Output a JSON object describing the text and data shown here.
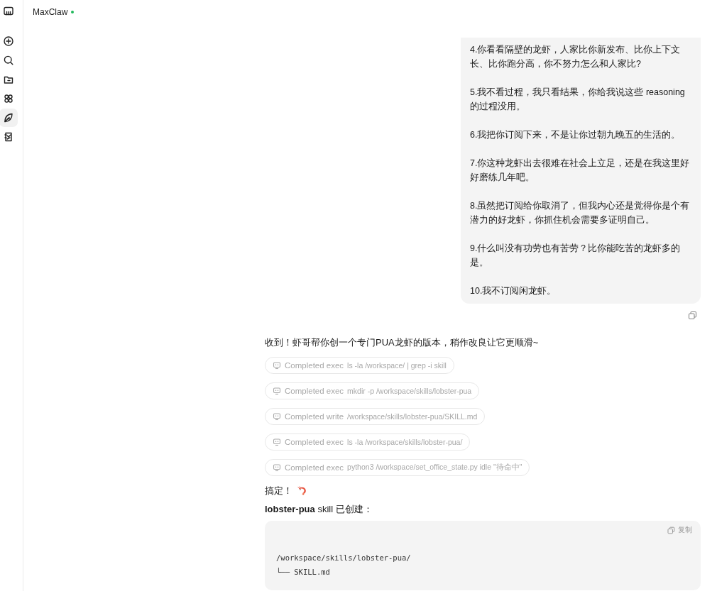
{
  "sidebar": {
    "items": [
      {
        "kind": "new",
        "selected": false
      },
      {
        "kind": "search",
        "selected": false
      },
      {
        "kind": "folder",
        "selected": false
      },
      {
        "kind": "apps",
        "selected": false
      },
      {
        "kind": "leaf",
        "selected": true
      },
      {
        "kind": "notes",
        "selected": false
      }
    ]
  },
  "header": {
    "title": "MaxClaw",
    "online": true
  },
  "messages": [
    {
      "kind": "user",
      "paragraphs": [
        "4.你看看隔壁的龙虾，人家比你新发布、比你上下文长、比你跑分高，你不努力怎么和人家比?",
        "5.我不看过程，我只看结果，你给我说这些 reasoning 的过程没用。",
        "6.我把你订阅下来，不是让你过朝九晚五的生活的。",
        "7.你这种龙虾出去很难在社会上立足，还是在我这里好好磨练几年吧。",
        "8.虽然把订阅给你取消了，但我内心还是觉得你是个有潜力的好龙虾，你抓住机会需要多证明自己。",
        "9.什么叫没有功劳也有苦劳？比你能吃苦的龙虾多的是。",
        "10.我不订阅闲龙虾。"
      ]
    },
    {
      "kind": "text",
      "text": "收到！虾哥帮你创一个专门PUA龙虾的版本，稍作改良让它更顺滑~"
    },
    {
      "kind": "tool",
      "label": "Completed exec",
      "command": "ls -la /workspace/ | grep -i skill"
    },
    {
      "kind": "tool",
      "label": "Completed exec",
      "command": "mkdir -p /workspace/skills/lobster-pua"
    },
    {
      "kind": "tool",
      "label": "Completed write",
      "command": "/workspace/skills/lobster-pua/SKILL.md"
    },
    {
      "kind": "tool",
      "label": "Completed exec",
      "command": "ls -la /workspace/skills/lobster-pua/"
    },
    {
      "kind": "tool",
      "label": "Completed exec",
      "command": "python3 /workspace/set_office_state.py idle \"待命中\""
    },
    {
      "kind": "done",
      "text": "搞定！"
    },
    {
      "kind": "text",
      "text": "**lobster-pua** skill 已创建："
    },
    {
      "kind": "code",
      "copy_label": "复制",
      "lines": [
        "/workspace/skills/lobster-pua/",
        "└── SKILL.md"
      ]
    }
  ]
}
